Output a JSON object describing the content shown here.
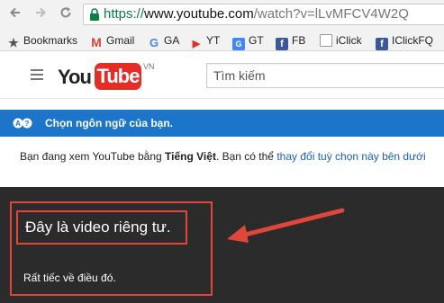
{
  "browser": {
    "url_proto": "https://",
    "url_host": "www.youtube.com",
    "url_path": "/watch?v=lLvMFCV4W2Q",
    "bookmarks": [
      {
        "icon": "star-icon",
        "label": "Bookmarks"
      },
      {
        "icon": "gmail-icon",
        "label": "Gmail"
      },
      {
        "icon": "google-icon",
        "label": "GA"
      },
      {
        "icon": "youtube-icon",
        "label": "YT"
      },
      {
        "icon": "translate-icon",
        "label": "GT"
      },
      {
        "icon": "facebook-icon",
        "label": "FB"
      },
      {
        "icon": "doc-icon",
        "label": "iClick"
      },
      {
        "icon": "facebook-icon",
        "label": "IClickFQ"
      }
    ]
  },
  "header": {
    "logo_you": "You",
    "logo_tube": "Tube",
    "logo_region": "VN",
    "search_placeholder": "Tìm kiếm"
  },
  "language_notice": {
    "title": "Chọn ngôn ngữ của bạn.",
    "text_prefix": "Bạn đang xem YouTube bằng ",
    "language": "Tiếng Việt",
    "text_middle": ". Bạn có thể ",
    "link": "thay đổi tuỳ chọn này bên dưới"
  },
  "player": {
    "title": "Đây là video riêng tư.",
    "subtitle": "Rất tiếc về điều đó."
  },
  "colors": {
    "annotation_red": "#e0463a",
    "banner_blue": "#1c75c8",
    "youtube_red": "#e52d27"
  }
}
